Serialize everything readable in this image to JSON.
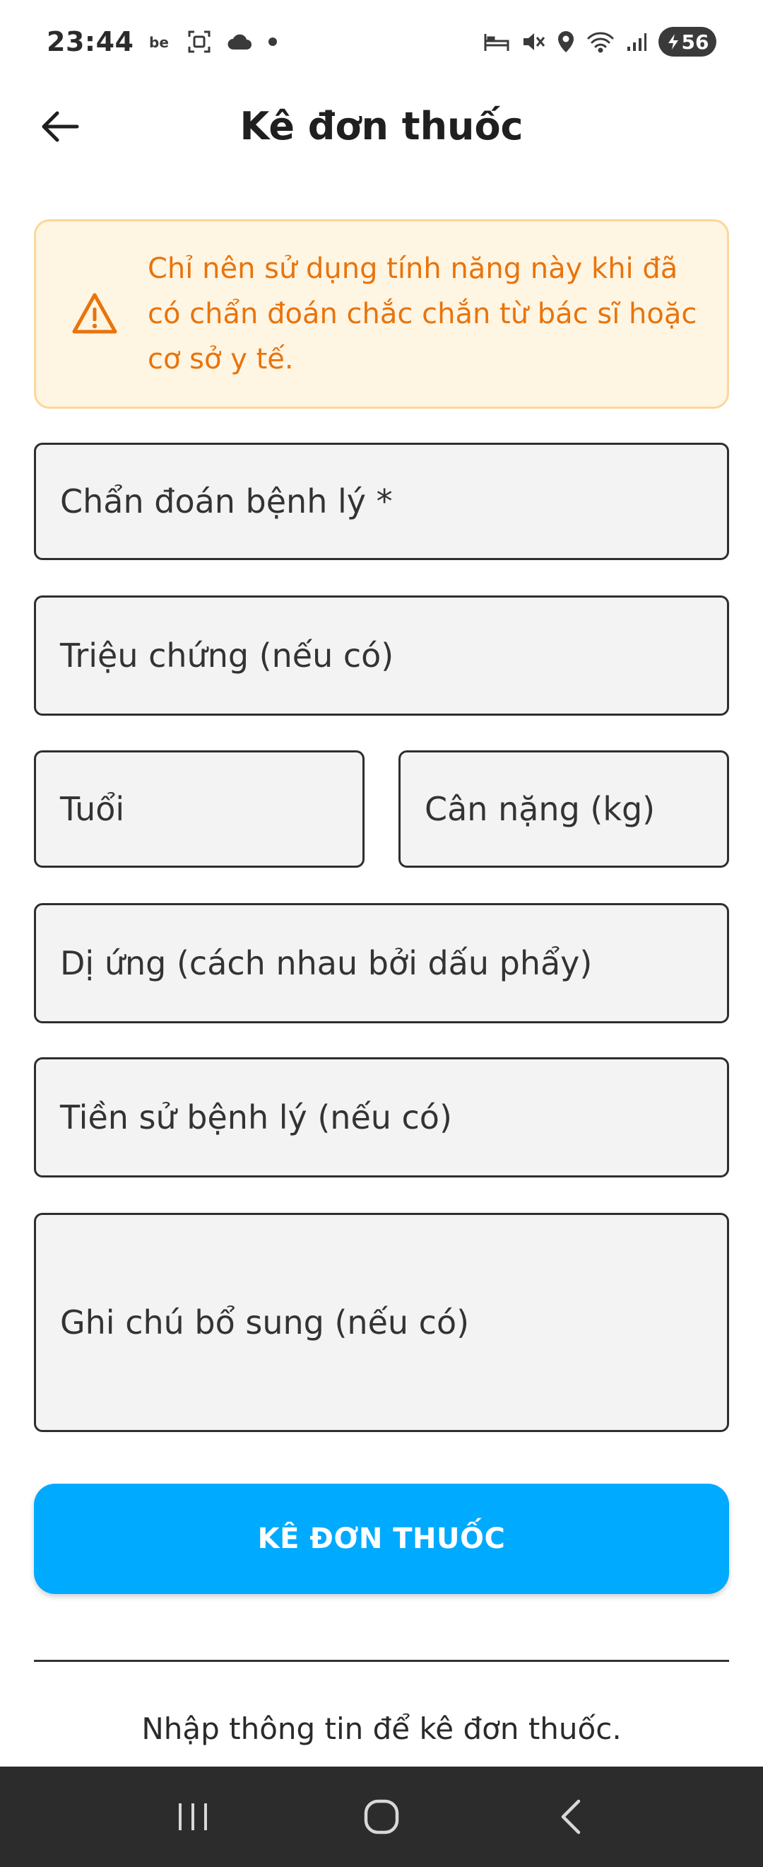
{
  "status_bar": {
    "time": "23:44",
    "left_icons": [
      "behance-icon",
      "screen-capture-icon",
      "cloud-icon",
      "dot-icon"
    ],
    "right_icons": [
      "bed-icon",
      "mute-icon",
      "location-icon",
      "wifi-icon",
      "signal-icon"
    ],
    "battery": "56"
  },
  "header": {
    "title": "Kê đơn thuốc",
    "back_icon": "arrow-left-icon"
  },
  "warning": {
    "icon": "warning-triangle-icon",
    "text": "Chỉ nên sử dụng tính năng này khi đã có chẩn đoán chắc chắn từ bác sĩ hoặc cơ sở y tế.",
    "colors": {
      "background": "#fff5e3",
      "border": "#fbd79a",
      "text": "#e8740c"
    }
  },
  "form": {
    "diagnosis_label": "Chẩn đoán bệnh lý *",
    "symptoms_label": "Triệu chứng (nếu có)",
    "age_label": "Tuổi",
    "weight_label": "Cân nặng (kg)",
    "allergies_label": "Dị ứng (cách nhau bởi dấu phẩy)",
    "history_label": "Tiền sử bệnh lý (nếu có)",
    "notes_label": "Ghi chú bổ sung (nếu có)"
  },
  "submit": {
    "label": "KÊ ĐƠN THUỐC",
    "color": "#00aaff"
  },
  "hint": "Nhập thông tin để kê đơn thuốc.",
  "nav_bar": {
    "icons": [
      "recent-apps-icon",
      "home-icon",
      "back-icon"
    ]
  }
}
